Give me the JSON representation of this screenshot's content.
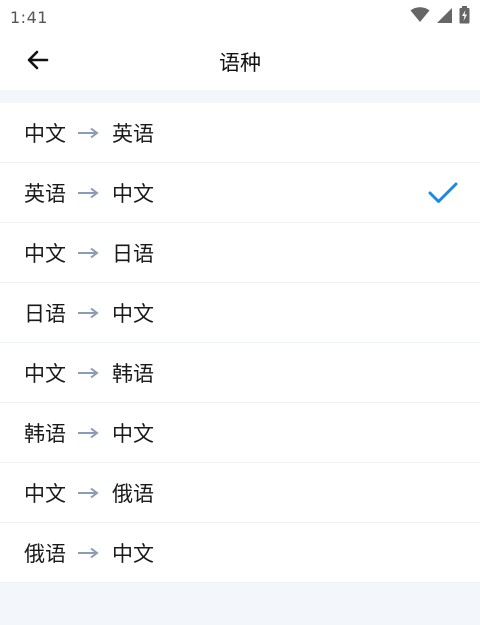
{
  "status": {
    "time": "1:41"
  },
  "appbar": {
    "title": "语种"
  },
  "languages": [
    {
      "from": "中文",
      "to": "英语",
      "selected": false
    },
    {
      "from": "英语",
      "to": "中文",
      "selected": true
    },
    {
      "from": "中文",
      "to": "日语",
      "selected": false
    },
    {
      "from": "日语",
      "to": "中文",
      "selected": false
    },
    {
      "from": "中文",
      "to": "韩语",
      "selected": false
    },
    {
      "from": "韩语",
      "to": "中文",
      "selected": false
    },
    {
      "from": "中文",
      "to": "俄语",
      "selected": false
    },
    {
      "from": "俄语",
      "to": "中文",
      "selected": false
    }
  ],
  "colors": {
    "accent": "#1e88e5",
    "arrow": "#8a9db5"
  },
  "icons": {
    "back": "arrow-left-icon",
    "check": "check-icon",
    "wifi": "wifi-icon",
    "signal": "cell-signal-icon",
    "battery": "battery-charging-icon"
  }
}
